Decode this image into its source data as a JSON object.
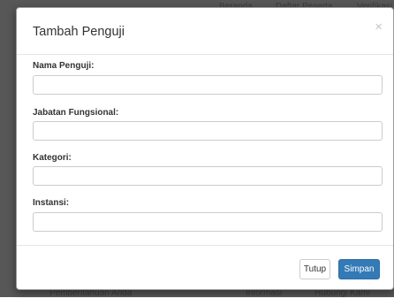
{
  "background": {
    "nav_beranda": "Beranda",
    "nav_daftar_peserta": "Daftar Peserta",
    "nav_verifikasi": "Verifikasi",
    "footer_left": "Pemberitahuan Anda",
    "footer_mid": "Informasi",
    "footer_right": "Hubungi Kami"
  },
  "modal": {
    "title": "Tambah Penguji",
    "close_symbol": "×",
    "fields": [
      {
        "label": "Nama Penguji:",
        "value": "",
        "placeholder": ""
      },
      {
        "label": "Jabatan Fungsional:",
        "value": "",
        "placeholder": ""
      },
      {
        "label": "Kategori:",
        "value": "",
        "placeholder": ""
      },
      {
        "label": "Instansi:",
        "value": "",
        "placeholder": ""
      }
    ],
    "buttons": {
      "close_label": "Tutup",
      "save_label": "Simpan"
    }
  },
  "colors": {
    "primary": "#337ab7",
    "backdrop": "#575757"
  }
}
